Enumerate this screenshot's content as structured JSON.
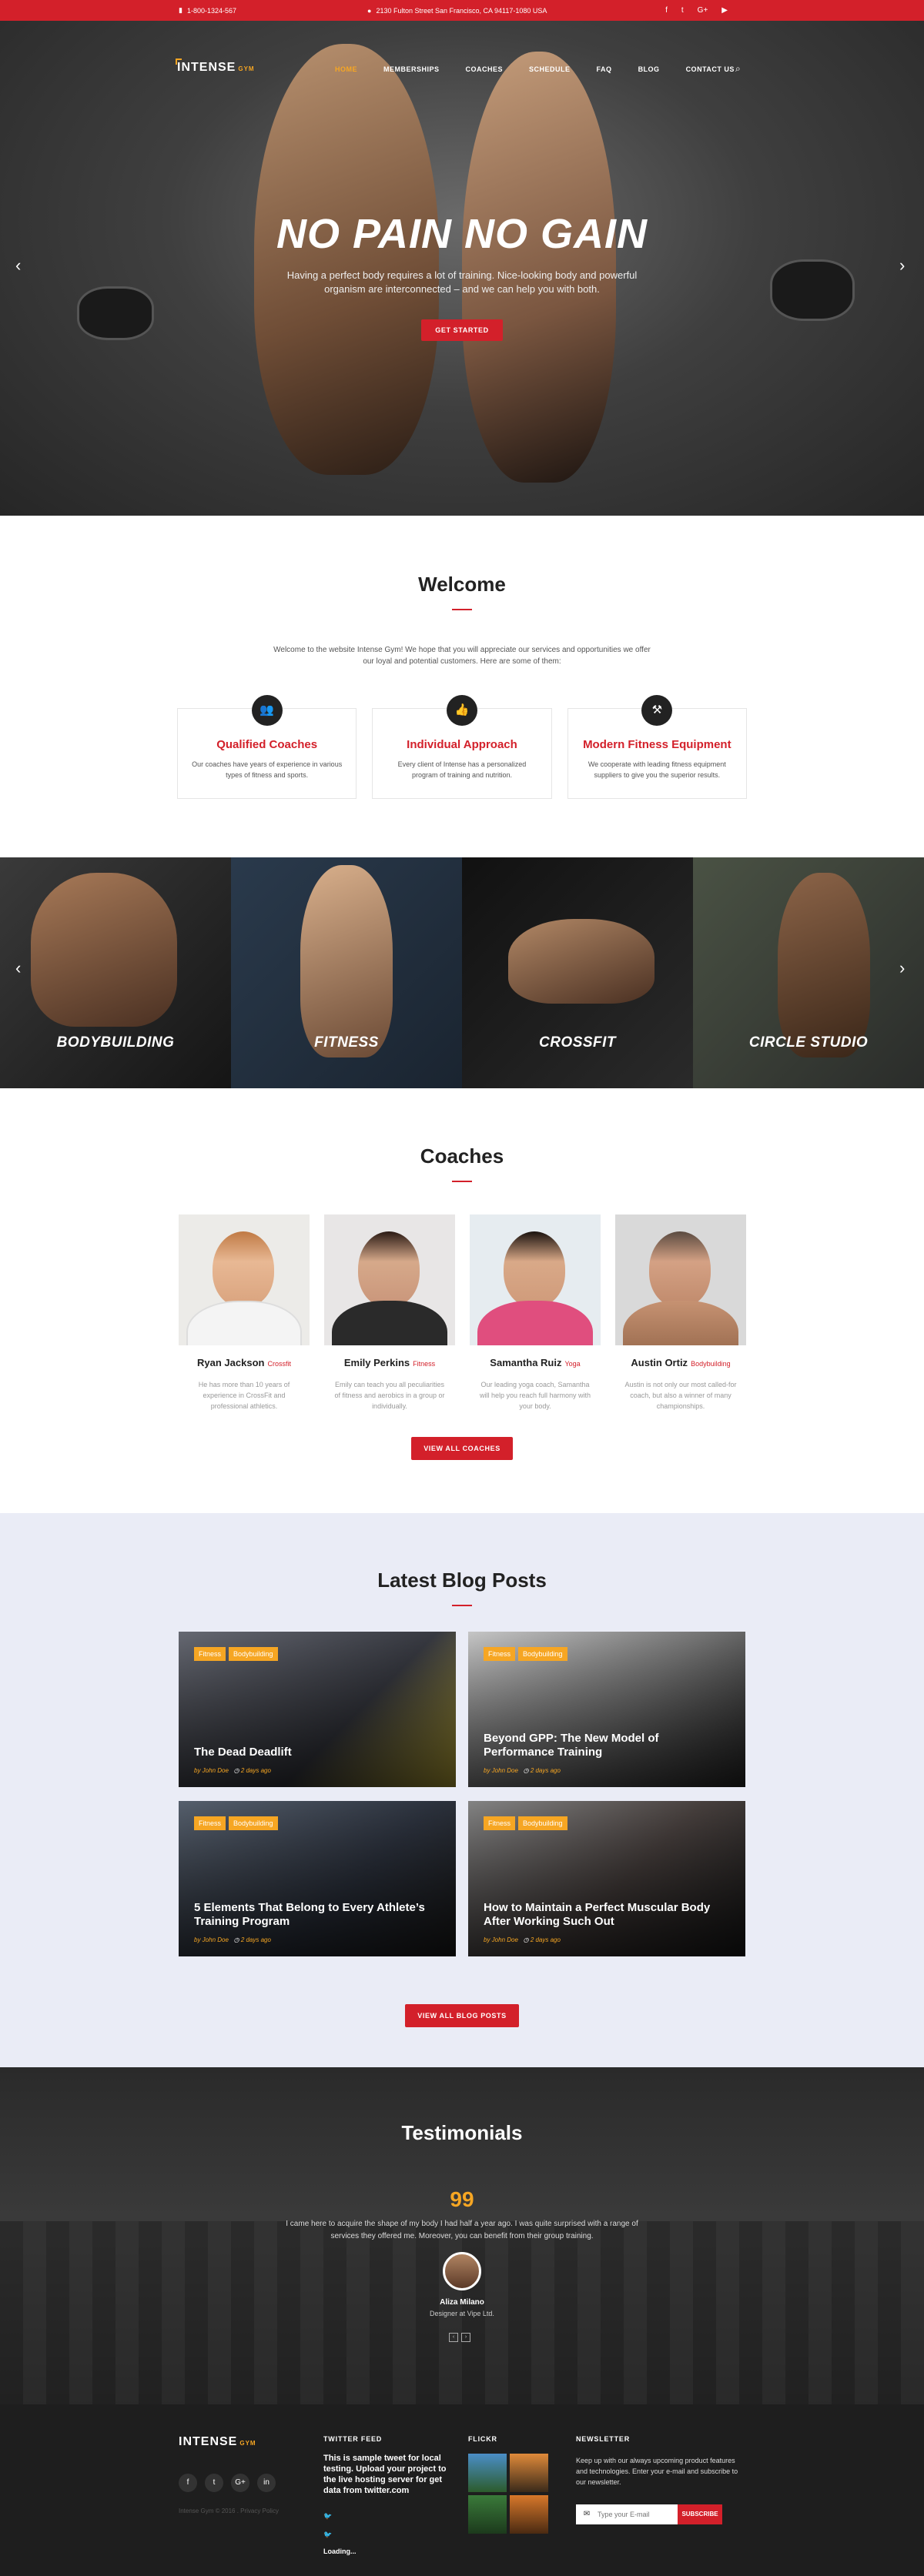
{
  "topbar": {
    "phone": "1-800-1324-567",
    "address": "2130 Fulton Street San Francisco, CA 94117-1080 USA",
    "social": [
      "f",
      "t",
      "G+",
      "▶"
    ]
  },
  "nav": {
    "logo": "INTENSE",
    "logo_sub": "GYM",
    "items": [
      "HOME",
      "MEMBERSHIPS",
      "COACHES",
      "SCHEDULE",
      "FAQ",
      "BLOG",
      "CONTACT US"
    ],
    "active": "HOME"
  },
  "hero": {
    "title": "NO PAIN NO GAIN",
    "text": "Having a perfect body requires a lot of training. Nice-looking body and powerful organism are interconnected – and we can help you with both.",
    "button": "GET STARTED"
  },
  "welcome": {
    "title": "Welcome",
    "intro": "Welcome to the website Intense Gym! We hope that you will appreciate our services and opportunities we offer our loyal and potential customers. Here are some of them:",
    "features": [
      {
        "icon": "users-icon",
        "glyph": "👥",
        "title": "Qualified Coaches",
        "text": "Our coaches have years of experience in various types of fitness and sports."
      },
      {
        "icon": "thumbs-up-icon",
        "glyph": "👍",
        "title": "Individual Approach",
        "text": "Every client of Intense has a personalized program of training and nutrition."
      },
      {
        "icon": "equipment-icon",
        "glyph": "⚒",
        "title": "Modern Fitness Equipment",
        "text": "We cooperate with leading fitness equipment suppliers to give you the superior results."
      }
    ]
  },
  "categories": [
    "BODYBUILDING",
    "FITNESS",
    "CROSSFIT",
    "CIRCLE STUDIO"
  ],
  "coaches": {
    "title": "Coaches",
    "button": "VIEW ALL COACHES",
    "list": [
      {
        "name": "Ryan Jackson",
        "tag": "Crossfit",
        "text": "He has more than 10 years of experience in CrossFit and professional athletics."
      },
      {
        "name": "Emily Perkins",
        "tag": "Fitness",
        "text": "Emily can teach you all peculiarities of fitness and aerobics in a group or individually."
      },
      {
        "name": "Samantha Ruiz",
        "tag": "Yoga",
        "text": "Our leading yoga coach, Samantha will help you reach full harmony with your body."
      },
      {
        "name": "Austin Ortiz",
        "tag": "Bodybuilding",
        "text": "Austin is not only our most called-for coach, but also a winner of many championships."
      }
    ]
  },
  "blog": {
    "title": "Latest Blog Posts",
    "button": "VIEW ALL BLOG POSTS",
    "posts": [
      {
        "tags": [
          "Fitness",
          "Bodybuilding"
        ],
        "title": "The Dead Deadlift",
        "author": "John Doe",
        "date": "2 days ago"
      },
      {
        "tags": [
          "Fitness",
          "Bodybuilding"
        ],
        "title": "Beyond GPP: The New Model of Performance Training",
        "author": "John Doe",
        "date": "2 days ago"
      },
      {
        "tags": [
          "Fitness",
          "Bodybuilding"
        ],
        "title": "5 Elements That Belong to Every Athlete’s Training Program",
        "author": "John Doe",
        "date": "2 days ago"
      },
      {
        "tags": [
          "Fitness",
          "Bodybuilding"
        ],
        "title": "How to Maintain a Perfect Muscular Body After Working Such Out",
        "author": "John Doe",
        "date": "2 days ago"
      }
    ]
  },
  "testimonials": {
    "title": "Testimonials",
    "quote_mark": "99",
    "text": "I came here to acquire the shape of my body I had half a year ago. I was quite surprised with a range of services they offered me. Moreover, you can benefit from their group training.",
    "name": "Aliza Milano",
    "role": "Designer at Vipe Ltd.",
    "prev": "‹",
    "next": "›"
  },
  "footer": {
    "logo": "INTENSE",
    "logo_sub": "GYM",
    "social": [
      "f",
      "t",
      "G+",
      "in"
    ],
    "copyright": "Intense Gym © 2016 . Privacy Policy",
    "twitter_title": "TWITTER FEED",
    "tweet": "This is sample tweet for local testing. Upload your project to the live hosting server for get data from twitter.com",
    "loading": "Loading...",
    "flickr_title": "FLICKR",
    "newsletter_title": "NEWSLETTER",
    "newsletter_text": "Keep up with our always upcoming product features and technologies. Enter your e-mail and subscribe to our newsletter.",
    "email_placeholder": "Type your E-mail",
    "subscribe": "SUBSCRIBE"
  },
  "colors": {
    "accent": "#d3202a",
    "secondary": "#f6a623",
    "blog_bg": "#eaecf6",
    "footer_bg": "#1e1e1e"
  }
}
